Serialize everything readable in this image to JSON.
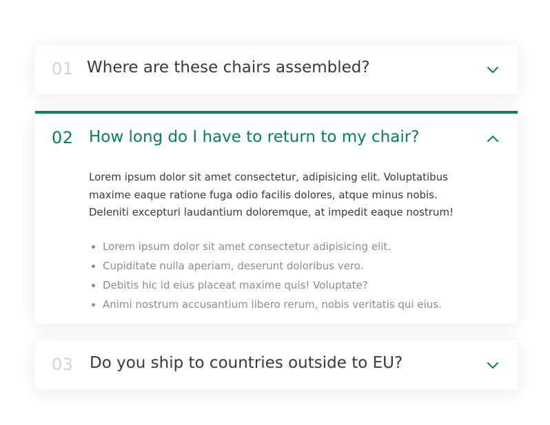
{
  "accent_color": "#087f5b",
  "items": [
    {
      "number": "01",
      "question": "Where are these chairs assembled?",
      "state": "collapsed",
      "icon": "chevron-down-icon"
    },
    {
      "number": "02",
      "question": "How long do I have to return to my chair?",
      "state": "expanded",
      "icon": "chevron-up-icon",
      "answer": "Lorem ipsum dolor sit amet consectetur, adipisicing elit. Voluptatibus maxime eaque ratione fuga odio facilis dolores, atque minus nobis. Deleniti excepturi laudantium doloremque, at impedit eaque nostrum!",
      "bullets": [
        "Lorem ipsum dolor sit amet consectetur adipisicing elit.",
        "Cupiditate nulla aperiam, deserunt doloribus vero.",
        "Debitis hic id eius placeat maxime quis! Voluptate?",
        "Animi nostrum accusantium libero rerum, nobis veritatis qui eius."
      ]
    },
    {
      "number": "03",
      "question": "Do you ship to countries outside to EU?",
      "state": "collapsed",
      "icon": "chevron-down-icon"
    }
  ]
}
